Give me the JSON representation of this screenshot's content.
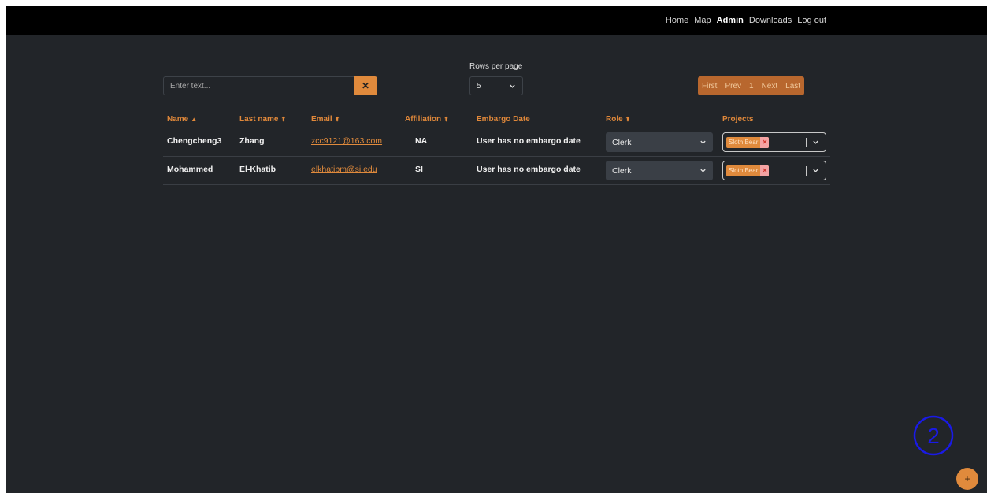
{
  "nav": {
    "links": [
      {
        "label": "Home",
        "active": false
      },
      {
        "label": "Map",
        "active": false
      },
      {
        "label": "Admin",
        "active": true
      },
      {
        "label": "Downloads",
        "active": false
      },
      {
        "label": "Log out",
        "active": false
      }
    ]
  },
  "search": {
    "placeholder": "Enter text...",
    "clear_icon": "x-icon"
  },
  "rows_per_page": {
    "label": "Rows per page",
    "value": "5"
  },
  "pagination": {
    "first": "First",
    "prev": "Prev",
    "page": "1",
    "next": "Next",
    "last": "Last"
  },
  "table": {
    "headers": {
      "name": "Name",
      "last_name": "Last name",
      "email": "Email",
      "affiliation": "Affiliation",
      "embargo_date": "Embargo Date",
      "role": "Role",
      "projects": "Projects"
    },
    "rows": [
      {
        "name": "Chengcheng3",
        "last_name": "Zhang",
        "email": "zcc9121@163.com",
        "affiliation": "NA",
        "embargo_date": "User has no embargo date",
        "role": "Clerk",
        "project_tag": "Sloth Bear"
      },
      {
        "name": "Mohammed",
        "last_name": "El-Khatib",
        "email": "elkhatibm@si.edu",
        "affiliation": "SI",
        "embargo_date": "User has no embargo date",
        "role": "Clerk",
        "project_tag": "Sloth Bear"
      }
    ]
  },
  "step_badge": "2",
  "fab_label": "+",
  "colors": {
    "accent": "#e08a3c",
    "background": "#222529",
    "navbar": "#000000",
    "badge_outline": "#1a1ae6"
  }
}
